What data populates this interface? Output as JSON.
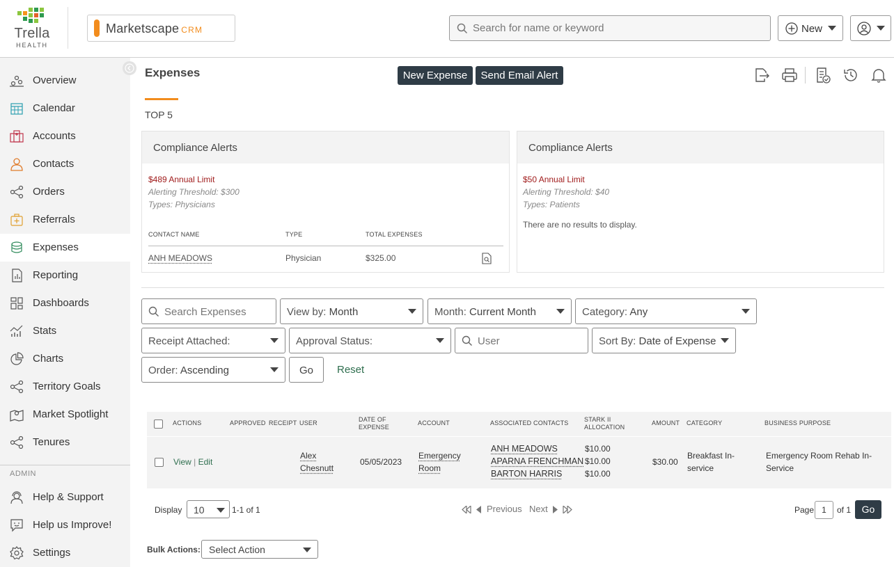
{
  "header": {
    "logo_name": "Trella",
    "logo_sub": "HEALTH",
    "brand": "Marketscape",
    "brand_suffix": "CRM",
    "search_placeholder": "Search for name or keyword",
    "new_label": "New"
  },
  "sidebar": {
    "items": [
      {
        "label": "Overview",
        "icon": "overview-icon"
      },
      {
        "label": "Calendar",
        "icon": "calendar-icon"
      },
      {
        "label": "Accounts",
        "icon": "accounts-icon"
      },
      {
        "label": "Contacts",
        "icon": "contacts-icon"
      },
      {
        "label": "Orders",
        "icon": "orders-icon"
      },
      {
        "label": "Referrals",
        "icon": "referrals-icon"
      },
      {
        "label": "Expenses",
        "icon": "expenses-icon"
      },
      {
        "label": "Reporting",
        "icon": "reporting-icon"
      },
      {
        "label": "Dashboards",
        "icon": "dashboards-icon"
      },
      {
        "label": "Stats",
        "icon": "stats-icon"
      },
      {
        "label": "Charts",
        "icon": "charts-icon"
      },
      {
        "label": "Territory Goals",
        "icon": "territory-goals-icon"
      },
      {
        "label": "Market Spotlight",
        "icon": "market-spotlight-icon"
      },
      {
        "label": "Tenures",
        "icon": "tenures-icon"
      }
    ],
    "admin_label": "ADMIN",
    "admin_items": [
      {
        "label": "Help & Support",
        "icon": "help-icon"
      },
      {
        "label": "Help us Improve!",
        "icon": "feedback-icon"
      },
      {
        "label": "Settings",
        "icon": "settings-icon"
      }
    ],
    "active": "Expenses"
  },
  "main": {
    "title": "Expenses",
    "new_expense": "New Expense",
    "send_alert": "Send Email Alert",
    "tab": "TOP 5"
  },
  "cards": [
    {
      "title": "Compliance Alerts",
      "limit": "$489 Annual Limit",
      "threshold": "Alerting Threshold: $300",
      "types": "Types: Physicians",
      "columns": [
        "CONTACT NAME",
        "TYPE",
        "TOTAL EXPENSES"
      ],
      "rows": [
        {
          "name": "ANH MEADOWS",
          "type": "Physician",
          "total": "$325.00"
        }
      ]
    },
    {
      "title": "Compliance Alerts",
      "limit": "$50 Annual Limit",
      "threshold": "Alerting Threshold: $40",
      "types": "Types: Patients",
      "empty": "There are no results to display."
    }
  ],
  "filters": {
    "search_placeholder": "Search Expenses",
    "view_by_label": "View by:",
    "view_by_value": "Month",
    "month_label": "Month:",
    "month_value": "Current Month",
    "category_label": "Category:",
    "category_value": "Any",
    "receipt_label": "Receipt Attached:",
    "approval_label": "Approval Status:",
    "user_placeholder": "User",
    "sort_label": "Sort By:",
    "sort_value": "Date of Expense",
    "order_label": "Order:",
    "order_value": "Ascending",
    "go": "Go",
    "reset": "Reset"
  },
  "table": {
    "headers": {
      "actions": "ACTIONS",
      "approved": "APPROVED",
      "receipt": "RECEIPT",
      "user": "USER",
      "date1": "DATE OF",
      "date2": "EXPENSE",
      "account": "ACCOUNT",
      "contacts": "ASSOCIATED CONTACTS",
      "stark1": "STARK II",
      "stark2": "ALLOCATION",
      "amount": "AMOUNT",
      "category": "CATEGORY",
      "purpose": "BUSINESS PURPOSE"
    },
    "rows": [
      {
        "view": "View",
        "edit": "Edit",
        "user1": "Alex",
        "user2": "Chesnutt",
        "date": "05/05/2023",
        "account1": "Emergency",
        "account2": "Room",
        "contacts": [
          "ANH MEADOWS",
          "APARNA FRENCHMAN",
          "BARTON HARRIS"
        ],
        "allocations": [
          "$10.00",
          "$10.00",
          "$10.00"
        ],
        "amount": "$30.00",
        "category1": "Breakfast In-",
        "category2": "service",
        "purpose1": "Emergency Room Rehab In-",
        "purpose2": "Service"
      }
    ]
  },
  "pager": {
    "display": "Display",
    "per_page": "10",
    "range": "1-1 of 1",
    "previous": "Previous",
    "next": "Next",
    "page": "Page",
    "page_num": "1",
    "of": "of 1",
    "go": "Go"
  },
  "bulk": {
    "label": "Bulk Actions:",
    "value": "Select Action"
  },
  "colors": {
    "accent": "#f28c1d",
    "dark_button": "#2f3c46",
    "alert_red": "#a01c1c",
    "link_green": "#2e6e4e"
  }
}
